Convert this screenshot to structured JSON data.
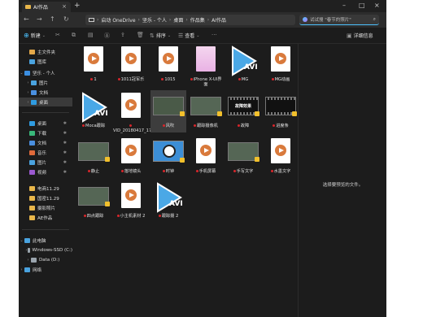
{
  "window": {
    "tab_title": "AI作品",
    "new_tab_symbol": "+"
  },
  "address": {
    "crumbs": [
      "启动 OneDrive",
      "坚乐 - 个人",
      "桌面",
      "作品集",
      "AI作品"
    ],
    "search_placeholder": "试试搜 \"春节的照片\""
  },
  "toolbar": {
    "new_label": "新建",
    "sort_label": "排序",
    "view_label": "查看",
    "details_label": "详细信息"
  },
  "sidebar": {
    "items": [
      {
        "label": "主文件夹",
        "icon": "home-icon",
        "color": "#e3a849",
        "expand": ""
      },
      {
        "label": "图库",
        "icon": "gallery-icon",
        "color": "#4aa3df",
        "expand": ""
      },
      {
        "label": "坚乐 - 个人",
        "icon": "onedrive-icon",
        "color": "#3b8ee0",
        "expand": "⌄"
      },
      {
        "label": "图片",
        "icon": "pictures-folder-icon",
        "color": "#4aa3df",
        "expand": "›"
      },
      {
        "label": "文档",
        "icon": "documents-folder-icon",
        "color": "#4a8fdf",
        "expand": "›"
      },
      {
        "label": "桌面",
        "icon": "desktop-folder-icon",
        "color": "#2f9be0",
        "expand": "›"
      },
      {
        "label": "桌面",
        "icon": "desktop-icon",
        "color": "#2f9be0",
        "expand": ""
      },
      {
        "label": "下载",
        "icon": "download-icon",
        "color": "#39b87a",
        "expand": ""
      },
      {
        "label": "文档",
        "icon": "documents-icon",
        "color": "#4a8fdf",
        "expand": ""
      },
      {
        "label": "音乐",
        "icon": "music-icon",
        "color": "#e06a3b",
        "expand": ""
      },
      {
        "label": "图片",
        "icon": "pictures-icon",
        "color": "#4aa3df",
        "expand": ""
      },
      {
        "label": "视频",
        "icon": "videos-icon",
        "color": "#9b59d0",
        "expand": ""
      },
      {
        "label": "电商11.29",
        "icon": "folder-icon",
        "color": "#e8b64a",
        "expand": ""
      },
      {
        "label": "国密11.29",
        "icon": "folder-icon",
        "color": "#e8b64a",
        "expand": ""
      },
      {
        "label": "摄影照片",
        "icon": "folder-icon",
        "color": "#e8b64a",
        "expand": ""
      },
      {
        "label": "AE作品",
        "icon": "folder-icon",
        "color": "#e8b64a",
        "expand": ""
      },
      {
        "label": "此电脑",
        "icon": "this-pc-icon",
        "color": "#4aa3df",
        "expand": "⌄"
      },
      {
        "label": "Windows-SSD (C:)",
        "icon": "drive-icon",
        "color": "#9aa4ad",
        "expand": "›"
      },
      {
        "label": "Data (D:)",
        "icon": "drive-icon",
        "color": "#9aa4ad",
        "expand": "›"
      },
      {
        "label": "网络",
        "icon": "network-icon",
        "color": "#4aa3df",
        "expand": "›"
      }
    ]
  },
  "files": [
    {
      "name": "1",
      "kind": "doc"
    },
    {
      "name": "1011冠军乐",
      "kind": "doc"
    },
    {
      "name": "1015",
      "kind": "doc"
    },
    {
      "name": "iPhone X-UI界面",
      "kind": "pinkdoc"
    },
    {
      "name": "MG",
      "kind": "avi"
    },
    {
      "name": "MG动画",
      "kind": "doc"
    },
    {
      "name": "Moca跟踪",
      "kind": "avi"
    },
    {
      "name": "VID_20180417_175952",
      "kind": "doc"
    },
    {
      "name": "风吹",
      "kind": "selvideo"
    },
    {
      "name": "跟踪摄像机",
      "kind": "video"
    },
    {
      "name": "故障",
      "kind": "film",
      "text": "故障效果"
    },
    {
      "name": "进度条",
      "kind": "film",
      "text": ""
    },
    {
      "name": "静止",
      "kind": "video"
    },
    {
      "name": "落地镜头",
      "kind": "doc"
    },
    {
      "name": "时钟",
      "kind": "clock"
    },
    {
      "name": "手机屏幕",
      "kind": "doc"
    },
    {
      "name": "手写文字",
      "kind": "video"
    },
    {
      "name": "水墨文字",
      "kind": "doc"
    },
    {
      "name": "四点跟踪",
      "kind": "video"
    },
    {
      "name": "小主机素材 2",
      "kind": "doc"
    },
    {
      "name": "跟踪摄 2",
      "kind": "avi"
    }
  ],
  "avi_label": "AVI",
  "preview": {
    "message": "选择要预览的文件。"
  }
}
